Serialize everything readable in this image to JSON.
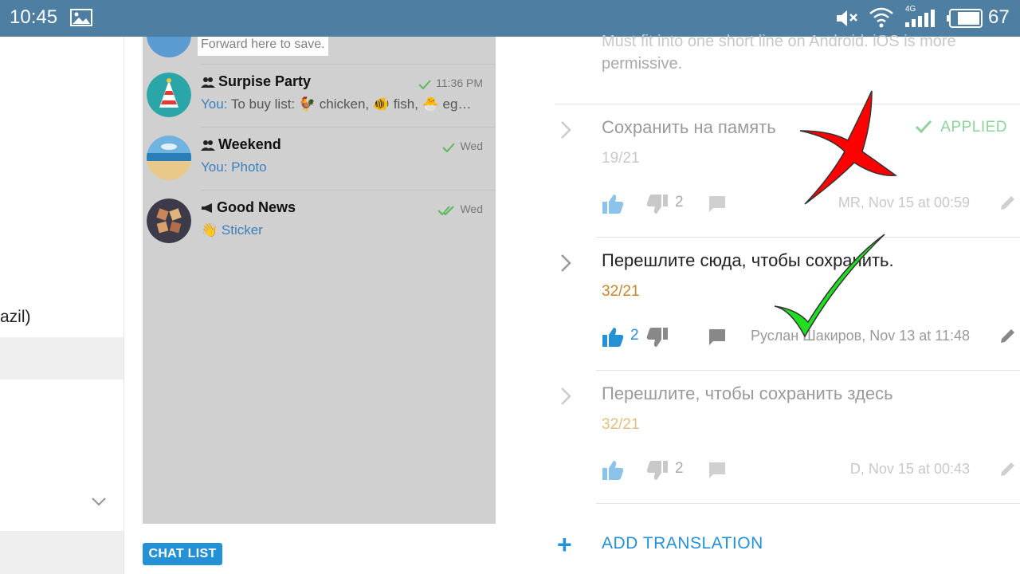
{
  "statusbar": {
    "time": "10:45",
    "network_label": "4G",
    "battery": "67",
    "icons": [
      "image-icon",
      "mute-icon",
      "wifi-icon",
      "signal-icon",
      "battery-icon"
    ]
  },
  "left_panel": {
    "partial_text": "azil)"
  },
  "phone_preview": {
    "saved_hint": "Forward here to save.",
    "chats": [
      {
        "name": "Surpise Party",
        "you_prefix": "You:",
        "message": " To buy list: 🐓 chicken, 🐠 fish, 🐣 eg…",
        "time": "11:36 PM",
        "status": "sent"
      },
      {
        "name": "Weekend",
        "you_prefix": "You:",
        "message": " Photo",
        "time": "Wed",
        "status": "sent"
      },
      {
        "name": "Good News",
        "you_prefix": "",
        "message": "👋 Sticker",
        "time": "Wed",
        "status": "read"
      }
    ],
    "chat_list_button": "CHAT LIST"
  },
  "translations": {
    "top_note_line1": "Must fit into one short line on Android. iOS is more",
    "top_note_line2": "permissive.",
    "items": [
      {
        "text": "Сохранить на память",
        "count": "19/21",
        "upvotes": "",
        "downvotes": "2",
        "author": "MR, Nov 15 at 00:59",
        "applied_label": "APPLIED"
      },
      {
        "text": "Перешлите сюда, чтобы сохранить.",
        "count": "32/21",
        "upvotes": "2",
        "downvotes": "",
        "author": "Руслан Шакиров, Nov 13 at 11:48"
      },
      {
        "text": "Перешлите, чтобы сохранить здесь",
        "count": "32/21",
        "upvotes": "",
        "downvotes": "2",
        "author": "D, Nov 15 at 00:43"
      }
    ],
    "add_translation": "ADD TRANSLATION"
  },
  "colors": {
    "statusbar": "#4f7ea3",
    "accent": "#2490d6",
    "applied": "#8ed39a",
    "count_over": "#c8862a",
    "overlay_red": "#ff0000",
    "overlay_green": "#22dd22"
  }
}
